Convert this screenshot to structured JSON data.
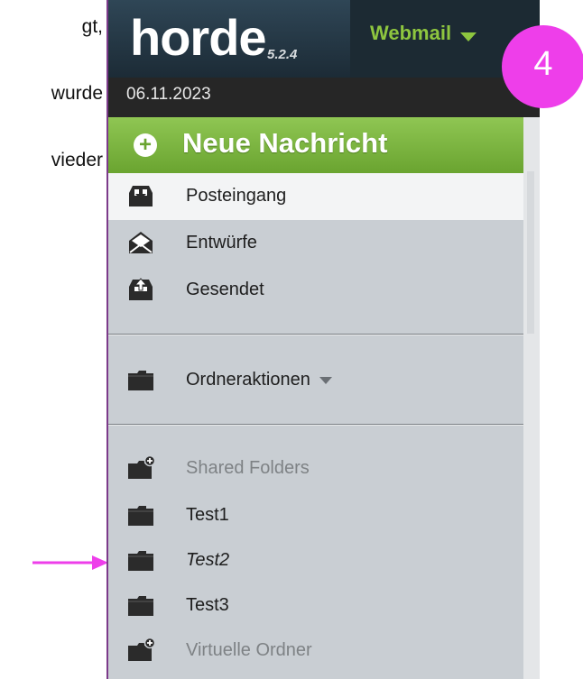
{
  "document": {
    "lines": [
      "gt,",
      "wurde",
      "vieder"
    ]
  },
  "header": {
    "logo": "horde",
    "version": "5.2.4",
    "app_menu": "Webmail",
    "date": "06.11.2023"
  },
  "annotation": {
    "step": "4",
    "badge_color": "#ee3eea",
    "arrow_color": "#ee3eea"
  },
  "sidebar": {
    "new_message": "Neue Nachricht",
    "mailboxes": [
      {
        "label": "Posteingang",
        "icon": "inbox-icon",
        "active": true
      },
      {
        "label": "Entwürfe",
        "icon": "drafts-icon"
      },
      {
        "label": "Gesendet",
        "icon": "sent-icon"
      }
    ],
    "folder_actions": "Ordneraktionen",
    "shared_folders": "Shared Folders",
    "folders": [
      {
        "label": "Test1",
        "icon": "folder-icon"
      },
      {
        "label": "Test2",
        "icon": "folder-icon",
        "italic": true
      },
      {
        "label": "Test3",
        "icon": "folder-icon"
      }
    ],
    "virtual_folders": "Virtuelle Ordner"
  },
  "colors": {
    "accent_green": "#7ab33f",
    "header_dark": "#1d2e3b",
    "sidebar_bg": "#c9ced3"
  }
}
